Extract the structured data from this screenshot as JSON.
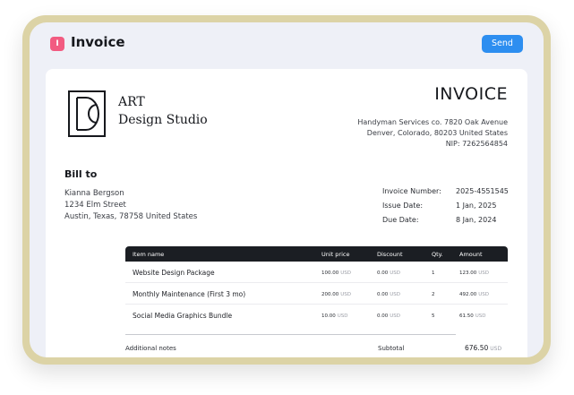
{
  "app": {
    "title": "Invoice",
    "icon": "document-icon",
    "icon_glyph": "I",
    "accent": "#f25b81"
  },
  "toolbar": {
    "send_label": "Send",
    "send_color": "#2d8ef0"
  },
  "brand": {
    "line1": "ART",
    "line2": "Design Studio",
    "logo": "dc-monogram-logo"
  },
  "invoice": {
    "title": "INVOICE",
    "from_line1": "Handyman Services co. 7820 Oak Avenue",
    "from_line2": "Denver, Colorado, 80203 United States",
    "from_line3": "NIP: 7262564854"
  },
  "bill_to": {
    "heading": "Bill to",
    "name": "Kianna Bergson",
    "street": "1234 Elm Street",
    "city": "Austin, Texas, 78758 United States"
  },
  "meta": {
    "number_label": "Invoice Number:",
    "number": "2025-4551545",
    "issue_label": "Issue Date:",
    "issue": "1 Jan, 2025",
    "due_label": "Due Date:",
    "due": "8 Jan, 2024"
  },
  "table": {
    "headers": [
      "Item name",
      "Unit price",
      "Discount",
      "Qty.",
      "Amount"
    ],
    "currency": "USD",
    "rows": [
      {
        "name": "Website Design Package",
        "unit": "100.00",
        "discount": "0.00",
        "qty": "1",
        "amount": "123.00"
      },
      {
        "name": "Monthly Maintenance (First 3 mo)",
        "unit": "200.00",
        "discount": "0.00",
        "qty": "2",
        "amount": "492.00"
      },
      {
        "name": "Social Media Graphics Bundle",
        "unit": "10.00",
        "discount": "0.00",
        "qty": "5",
        "amount": "61.50"
      }
    ]
  },
  "footer": {
    "notes_label": "Additional notes",
    "subtotal_label": "Subtotal",
    "subtotal": "676.50",
    "currency": "USD"
  }
}
